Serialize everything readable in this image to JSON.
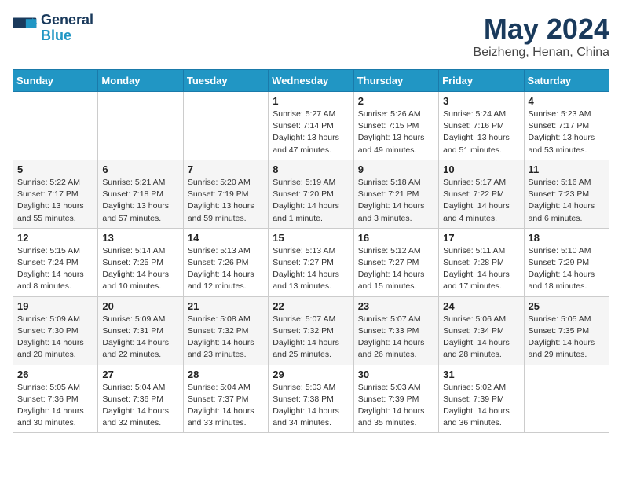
{
  "header": {
    "logo_line1": "General",
    "logo_line2": "Blue",
    "title": "May 2024",
    "subtitle": "Beizheng, Henan, China"
  },
  "weekdays": [
    "Sunday",
    "Monday",
    "Tuesday",
    "Wednesday",
    "Thursday",
    "Friday",
    "Saturday"
  ],
  "weeks": [
    [
      {
        "day": "",
        "info": ""
      },
      {
        "day": "",
        "info": ""
      },
      {
        "day": "",
        "info": ""
      },
      {
        "day": "1",
        "info": "Sunrise: 5:27 AM\nSunset: 7:14 PM\nDaylight: 13 hours\nand 47 minutes."
      },
      {
        "day": "2",
        "info": "Sunrise: 5:26 AM\nSunset: 7:15 PM\nDaylight: 13 hours\nand 49 minutes."
      },
      {
        "day": "3",
        "info": "Sunrise: 5:24 AM\nSunset: 7:16 PM\nDaylight: 13 hours\nand 51 minutes."
      },
      {
        "day": "4",
        "info": "Sunrise: 5:23 AM\nSunset: 7:17 PM\nDaylight: 13 hours\nand 53 minutes."
      }
    ],
    [
      {
        "day": "5",
        "info": "Sunrise: 5:22 AM\nSunset: 7:17 PM\nDaylight: 13 hours\nand 55 minutes."
      },
      {
        "day": "6",
        "info": "Sunrise: 5:21 AM\nSunset: 7:18 PM\nDaylight: 13 hours\nand 57 minutes."
      },
      {
        "day": "7",
        "info": "Sunrise: 5:20 AM\nSunset: 7:19 PM\nDaylight: 13 hours\nand 59 minutes."
      },
      {
        "day": "8",
        "info": "Sunrise: 5:19 AM\nSunset: 7:20 PM\nDaylight: 14 hours\nand 1 minute."
      },
      {
        "day": "9",
        "info": "Sunrise: 5:18 AM\nSunset: 7:21 PM\nDaylight: 14 hours\nand 3 minutes."
      },
      {
        "day": "10",
        "info": "Sunrise: 5:17 AM\nSunset: 7:22 PM\nDaylight: 14 hours\nand 4 minutes."
      },
      {
        "day": "11",
        "info": "Sunrise: 5:16 AM\nSunset: 7:23 PM\nDaylight: 14 hours\nand 6 minutes."
      }
    ],
    [
      {
        "day": "12",
        "info": "Sunrise: 5:15 AM\nSunset: 7:24 PM\nDaylight: 14 hours\nand 8 minutes."
      },
      {
        "day": "13",
        "info": "Sunrise: 5:14 AM\nSunset: 7:25 PM\nDaylight: 14 hours\nand 10 minutes."
      },
      {
        "day": "14",
        "info": "Sunrise: 5:13 AM\nSunset: 7:26 PM\nDaylight: 14 hours\nand 12 minutes."
      },
      {
        "day": "15",
        "info": "Sunrise: 5:13 AM\nSunset: 7:27 PM\nDaylight: 14 hours\nand 13 minutes."
      },
      {
        "day": "16",
        "info": "Sunrise: 5:12 AM\nSunset: 7:27 PM\nDaylight: 14 hours\nand 15 minutes."
      },
      {
        "day": "17",
        "info": "Sunrise: 5:11 AM\nSunset: 7:28 PM\nDaylight: 14 hours\nand 17 minutes."
      },
      {
        "day": "18",
        "info": "Sunrise: 5:10 AM\nSunset: 7:29 PM\nDaylight: 14 hours\nand 18 minutes."
      }
    ],
    [
      {
        "day": "19",
        "info": "Sunrise: 5:09 AM\nSunset: 7:30 PM\nDaylight: 14 hours\nand 20 minutes."
      },
      {
        "day": "20",
        "info": "Sunrise: 5:09 AM\nSunset: 7:31 PM\nDaylight: 14 hours\nand 22 minutes."
      },
      {
        "day": "21",
        "info": "Sunrise: 5:08 AM\nSunset: 7:32 PM\nDaylight: 14 hours\nand 23 minutes."
      },
      {
        "day": "22",
        "info": "Sunrise: 5:07 AM\nSunset: 7:32 PM\nDaylight: 14 hours\nand 25 minutes."
      },
      {
        "day": "23",
        "info": "Sunrise: 5:07 AM\nSunset: 7:33 PM\nDaylight: 14 hours\nand 26 minutes."
      },
      {
        "day": "24",
        "info": "Sunrise: 5:06 AM\nSunset: 7:34 PM\nDaylight: 14 hours\nand 28 minutes."
      },
      {
        "day": "25",
        "info": "Sunrise: 5:05 AM\nSunset: 7:35 PM\nDaylight: 14 hours\nand 29 minutes."
      }
    ],
    [
      {
        "day": "26",
        "info": "Sunrise: 5:05 AM\nSunset: 7:36 PM\nDaylight: 14 hours\nand 30 minutes."
      },
      {
        "day": "27",
        "info": "Sunrise: 5:04 AM\nSunset: 7:36 PM\nDaylight: 14 hours\nand 32 minutes."
      },
      {
        "day": "28",
        "info": "Sunrise: 5:04 AM\nSunset: 7:37 PM\nDaylight: 14 hours\nand 33 minutes."
      },
      {
        "day": "29",
        "info": "Sunrise: 5:03 AM\nSunset: 7:38 PM\nDaylight: 14 hours\nand 34 minutes."
      },
      {
        "day": "30",
        "info": "Sunrise: 5:03 AM\nSunset: 7:39 PM\nDaylight: 14 hours\nand 35 minutes."
      },
      {
        "day": "31",
        "info": "Sunrise: 5:02 AM\nSunset: 7:39 PM\nDaylight: 14 hours\nand 36 minutes."
      },
      {
        "day": "",
        "info": ""
      }
    ]
  ]
}
